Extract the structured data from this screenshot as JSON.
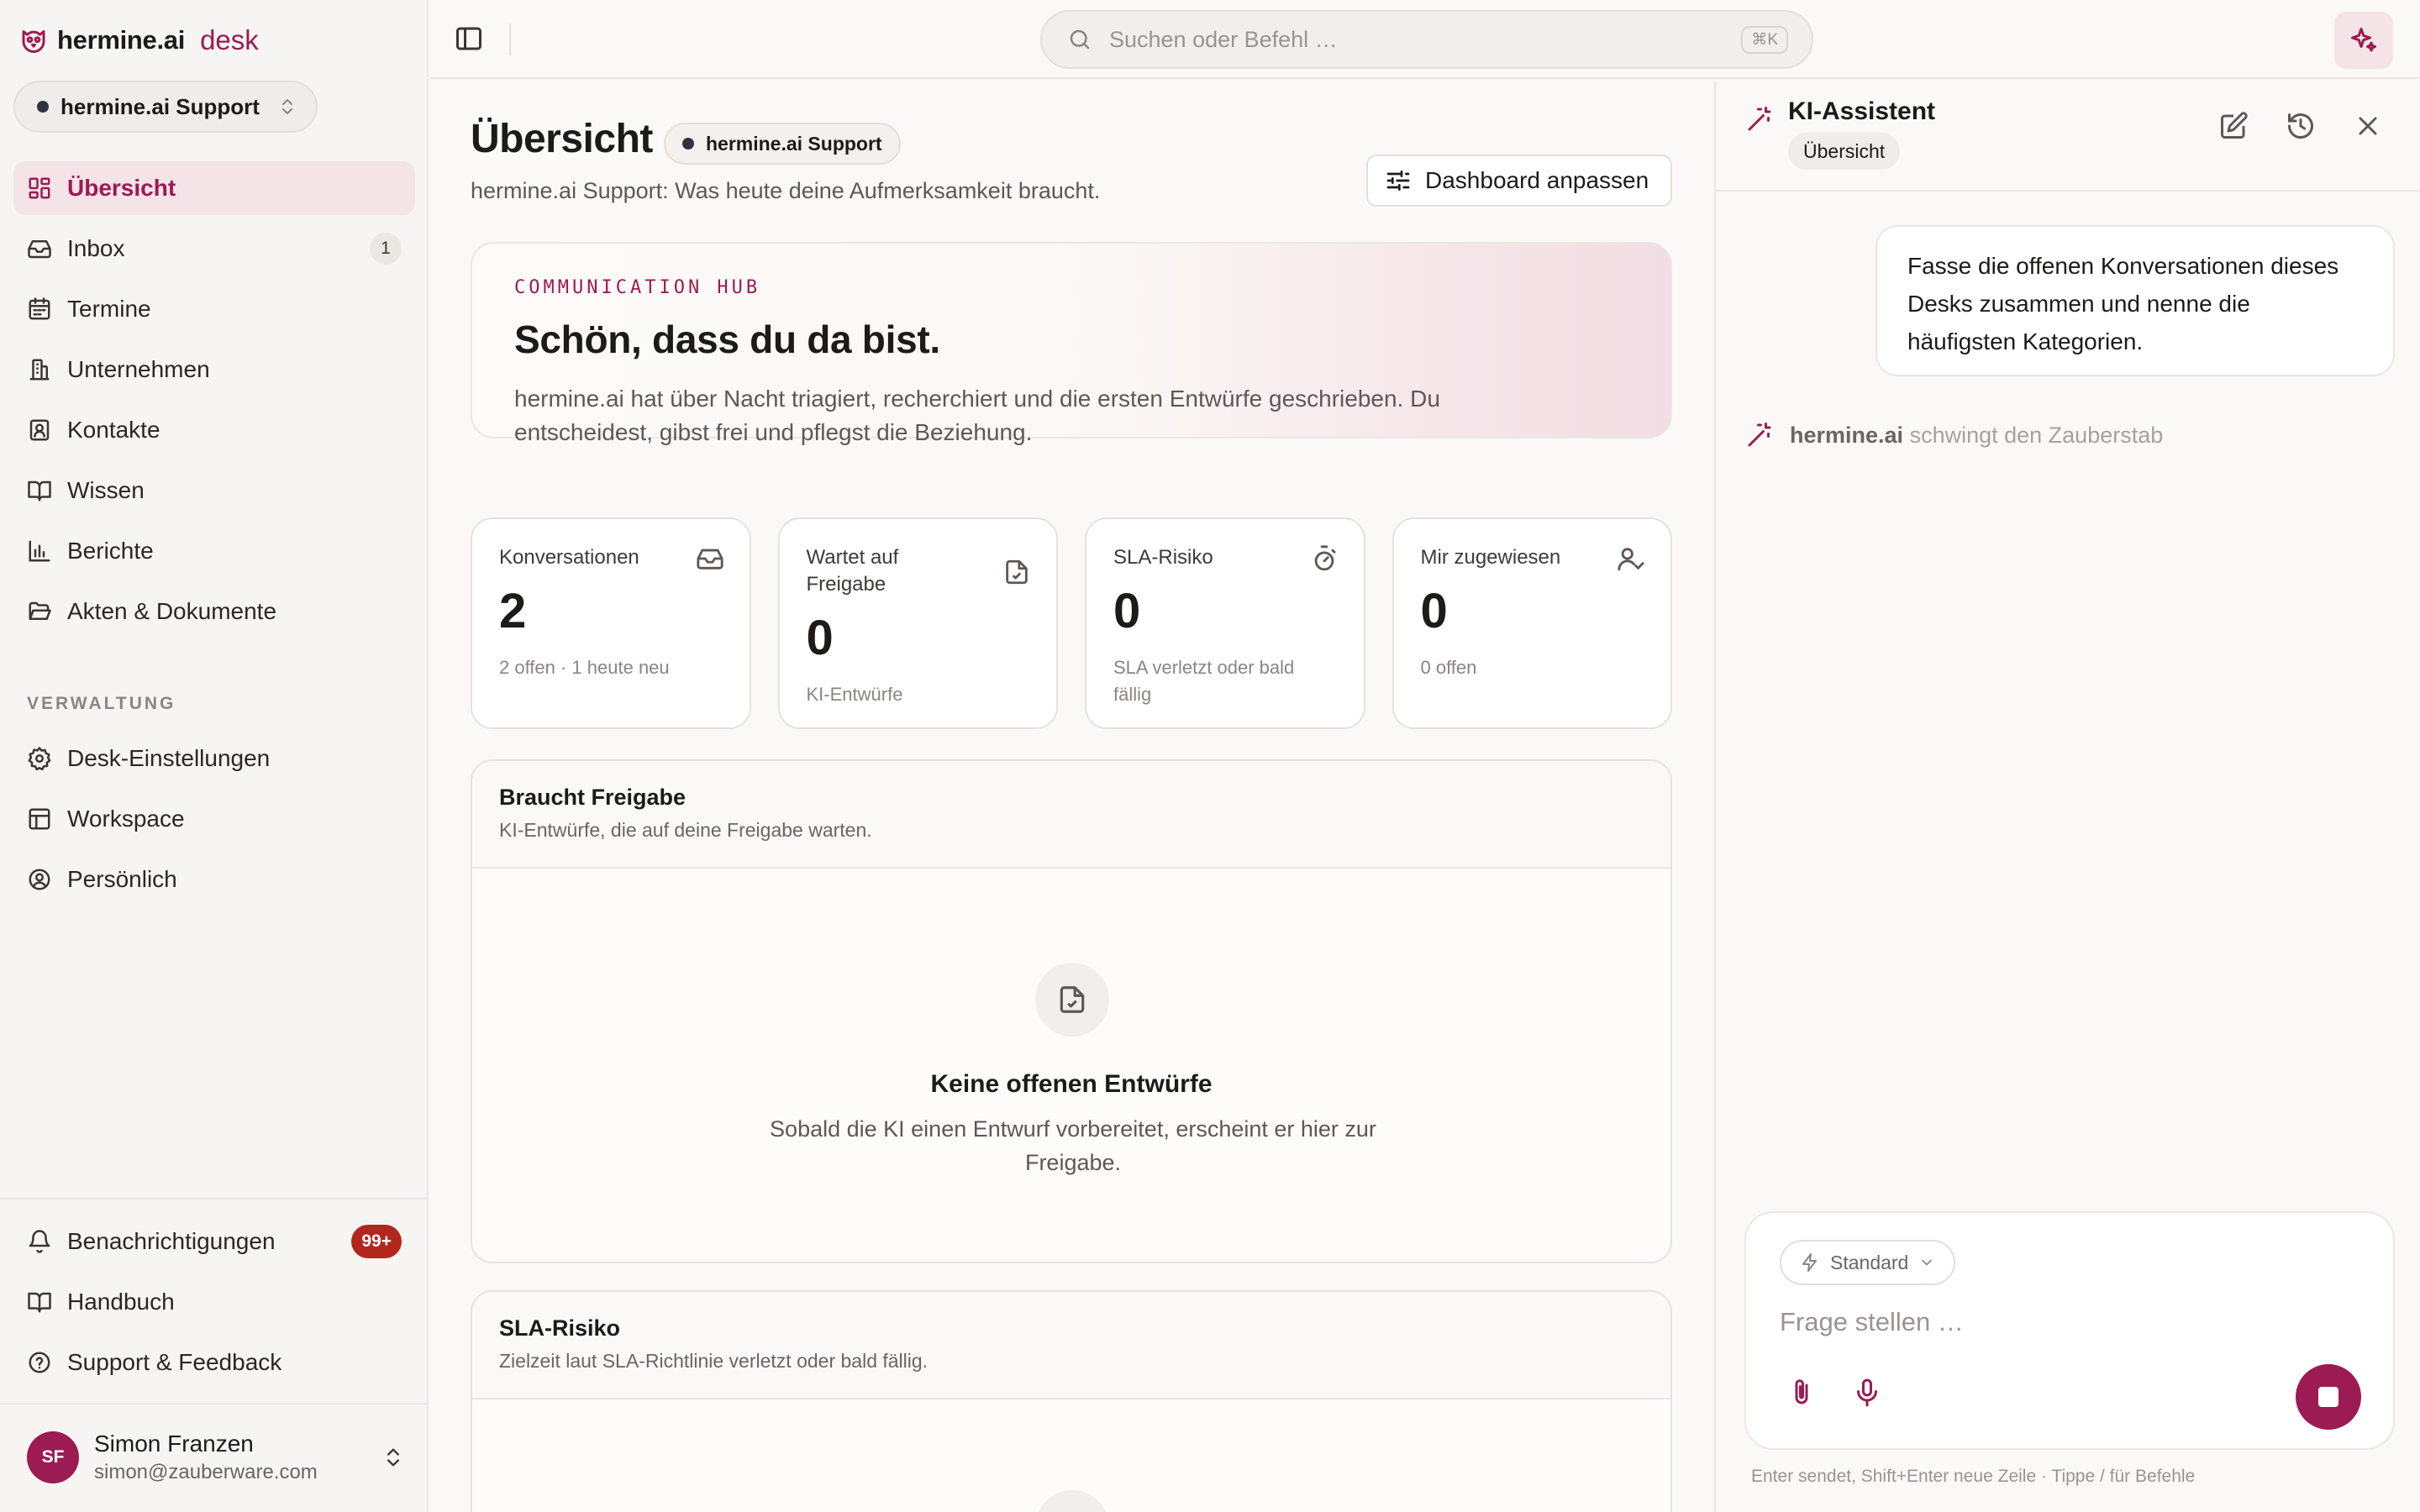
{
  "brand": {
    "name": "hermine.ai",
    "product": "desk",
    "accent": "#9c1b52"
  },
  "desk_switcher": {
    "label": "hermine.ai Support"
  },
  "nav": {
    "main": [
      {
        "label": "Übersicht",
        "icon": "dashboard-grid-icon",
        "active": true
      },
      {
        "label": "Inbox",
        "icon": "inbox-icon",
        "badge": "1"
      },
      {
        "label": "Termine",
        "icon": "calendar-icon"
      },
      {
        "label": "Unternehmen",
        "icon": "building-icon"
      },
      {
        "label": "Kontakte",
        "icon": "contact-card-icon"
      },
      {
        "label": "Wissen",
        "icon": "book-open-icon"
      },
      {
        "label": "Berichte",
        "icon": "bar-chart-icon"
      },
      {
        "label": "Akten & Dokumente",
        "icon": "folder-open-icon"
      }
    ],
    "section_label": "VERWALTUNG",
    "admin": [
      {
        "label": "Desk-Einstellungen",
        "icon": "gear-icon"
      },
      {
        "label": "Workspace",
        "icon": "layout-icon"
      },
      {
        "label": "Persönlich",
        "icon": "user-circle-icon"
      }
    ],
    "bottom": [
      {
        "label": "Benachrichtigungen",
        "icon": "bell-icon",
        "badge": "99+"
      },
      {
        "label": "Handbuch",
        "icon": "book-icon"
      },
      {
        "label": "Support & Feedback",
        "icon": "help-circle-icon"
      }
    ]
  },
  "user": {
    "initials": "SF",
    "name": "Simon Franzen",
    "email": "simon@zauberware.com"
  },
  "topbar": {
    "search_placeholder": "Suchen oder Befehl …",
    "shortcut": "⌘K"
  },
  "page": {
    "title": "Übersicht",
    "chip": "hermine.ai Support",
    "subtitle": "hermine.ai Support: Was heute deine Aufmerksamkeit braucht.",
    "customize_label": "Dashboard anpassen"
  },
  "hub": {
    "eyebrow": "COMMUNICATION HUB",
    "title": "Schön, dass du da bist.",
    "text": "hermine.ai hat über Nacht triagiert, recherchiert und die ersten Entwürfe geschrieben. Du entscheidest, gibst frei und pflegst die Beziehung."
  },
  "stats": [
    {
      "label": "Konversationen",
      "value": "2",
      "sub": "2 offen · 1 heute neu",
      "icon": "inbox-icon"
    },
    {
      "label": "Wartet auf Freigabe",
      "value": "0",
      "sub": "KI-Entwürfe",
      "icon": "file-check-icon"
    },
    {
      "label": "SLA-Risiko",
      "value": "0",
      "sub": "SLA verletzt oder bald fällig",
      "icon": "timer-icon"
    },
    {
      "label": "Mir zugewiesen",
      "value": "0",
      "sub": "0 offen",
      "icon": "user-check-icon"
    }
  ],
  "panels": {
    "approval": {
      "title": "Braucht Freigabe",
      "subtitle": "KI-Entwürfe, die auf deine Freigabe warten.",
      "empty_title": "Keine offenen Entwürfe",
      "empty_text": "Sobald die KI einen Entwurf vorbereitet, erscheint er hier zur Freigabe."
    },
    "sla": {
      "title": "SLA-Risiko",
      "subtitle": "Zielzeit laut SLA-Richtlinie verletzt oder bald fällig."
    }
  },
  "assistant": {
    "title": "KI-Assistent",
    "context_chip": "Übersicht",
    "user_message": "Fasse die offenen Konversationen dieses Desks zusammen und nenne die häufigsten Kategorien.",
    "status_brand": "hermine.ai",
    "status_text": "schwingt den Zauberstab",
    "mode": "Standard",
    "input_placeholder": "Frage stellen …",
    "hint": "Enter sendet, Shift+Enter neue Zeile · Tippe / für Befehle"
  }
}
